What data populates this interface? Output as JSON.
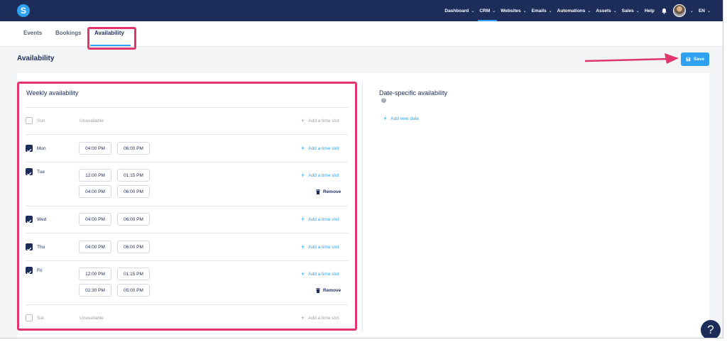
{
  "nav": {
    "logo_letter": "S",
    "items": [
      {
        "label": "Dashboard",
        "active": false
      },
      {
        "label": "CRM",
        "active": true
      },
      {
        "label": "Websites",
        "active": false
      },
      {
        "label": "Emails",
        "active": false
      },
      {
        "label": "Automations",
        "active": false
      },
      {
        "label": "Assets",
        "active": false
      },
      {
        "label": "Sales",
        "active": false
      }
    ],
    "help_label": "Help",
    "language": "EN"
  },
  "tabs": [
    {
      "label": "Events",
      "active": false
    },
    {
      "label": "Bookings",
      "active": false
    },
    {
      "label": "Availability",
      "active": true
    }
  ],
  "page": {
    "title": "Availability",
    "save_label": "Save"
  },
  "weekly": {
    "title": "Weekly availability",
    "add_slot_label": "Add a time slot",
    "remove_label": "Remove",
    "unavailable_label": "Unavailable",
    "days": [
      {
        "name": "Sun",
        "checked": false,
        "slots": []
      },
      {
        "name": "Mon",
        "checked": true,
        "slots": [
          {
            "start": "04:00 PM",
            "end": "06:00 PM"
          }
        ]
      },
      {
        "name": "Tue",
        "checked": true,
        "slots": [
          {
            "start": "12:00 PM",
            "end": "01:15 PM"
          },
          {
            "start": "04:00 PM",
            "end": "06:00 PM"
          }
        ]
      },
      {
        "name": "Wed",
        "checked": true,
        "slots": [
          {
            "start": "04:00 PM",
            "end": "06:00 PM"
          }
        ]
      },
      {
        "name": "Thu",
        "checked": true,
        "slots": [
          {
            "start": "04:00 PM",
            "end": "06:00 PM"
          }
        ]
      },
      {
        "name": "Fri",
        "checked": true,
        "slots": [
          {
            "start": "12:00 PM",
            "end": "01:15 PM"
          },
          {
            "start": "02:30 PM",
            "end": "05:00 PM"
          }
        ]
      },
      {
        "name": "Sat",
        "checked": false,
        "slots": []
      }
    ]
  },
  "date_specific": {
    "title": "Date-specific availability",
    "info_glyph": "?",
    "add_label": "Add new date"
  },
  "help_button_glyph": "?",
  "colors": {
    "nav_bg": "#1d2d5a",
    "accent": "#2ea2f0",
    "highlight": "#e0366b"
  }
}
